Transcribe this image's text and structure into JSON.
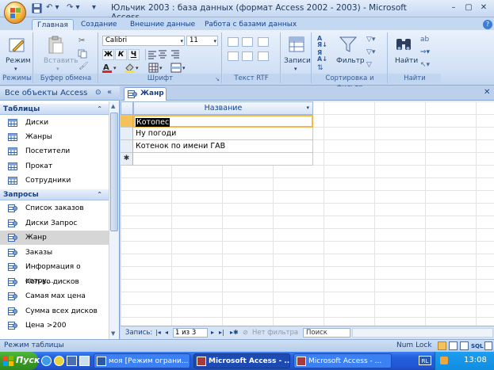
{
  "window": {
    "title": "Юльчик 2003 : база данных (формат Access 2002 - 2003) - Microsoft Access",
    "minimize_glyph": "–",
    "maximize_glyph": "▢",
    "close_glyph": "✕"
  },
  "ribbon": {
    "tabs": [
      "Главная",
      "Создание",
      "Внешние данные",
      "Работа с базами данных"
    ],
    "active_tab": "Главная",
    "groups": {
      "views": {
        "label": "Режимы",
        "mode_button": "Режим"
      },
      "clipboard": {
        "label": "Буфер обмена",
        "paste_button": "Вставить"
      },
      "font": {
        "label": "Шрифт",
        "font_name": "Calibri",
        "font_size": "11",
        "bold": "Ж",
        "italic": "К",
        "underline": "Ч"
      },
      "rtf": {
        "label": "Текст RTF"
      },
      "records": {
        "label": "",
        "records_button": "Записи"
      },
      "sort_filter": {
        "label": "Сортировка и фильтр",
        "filter_button": "Фильтр"
      },
      "find": {
        "label": "Найти",
        "find_button": "Найти"
      }
    }
  },
  "nav": {
    "header": "Все объекты Access",
    "sections": [
      {
        "title": "Таблицы",
        "items": [
          "Диски",
          "Жанры",
          "Посетители",
          "Прокат",
          "Сотрудники"
        ]
      },
      {
        "title": "Запросы",
        "items": [
          "Список заказов",
          "Диски Запрос",
          "Жанр",
          "Заказы",
          "Информация о сотру...",
          "Кол-во дисков",
          "Самая мах цена",
          "Сумма всех дисков",
          "Цена >200"
        ]
      }
    ],
    "selected_item": "Жанр"
  },
  "document": {
    "tab_title": "Жанр",
    "column_header": "Название",
    "rows": [
      "Котопес",
      "Ну погоди",
      "Котенок по имени ГАВ"
    ],
    "new_row_marker": "✱"
  },
  "record_nav": {
    "label": "Запись:",
    "position": "1 из 3",
    "filter_status": "Нет фильтра",
    "search_label": "Поиск"
  },
  "status": {
    "left": "Режим таблицы",
    "num_lock": "Num Lock"
  },
  "taskbar": {
    "start": "Пуск",
    "tasks": [
      "моя [Режим ограни...",
      "Microsoft Access - ...",
      "Microsoft Access - ..."
    ],
    "lang": "RL",
    "time": "13:08"
  },
  "colors": {
    "accent": "#15428b",
    "selection_highlight": "#000000",
    "office_orange": "#f0a53b"
  }
}
